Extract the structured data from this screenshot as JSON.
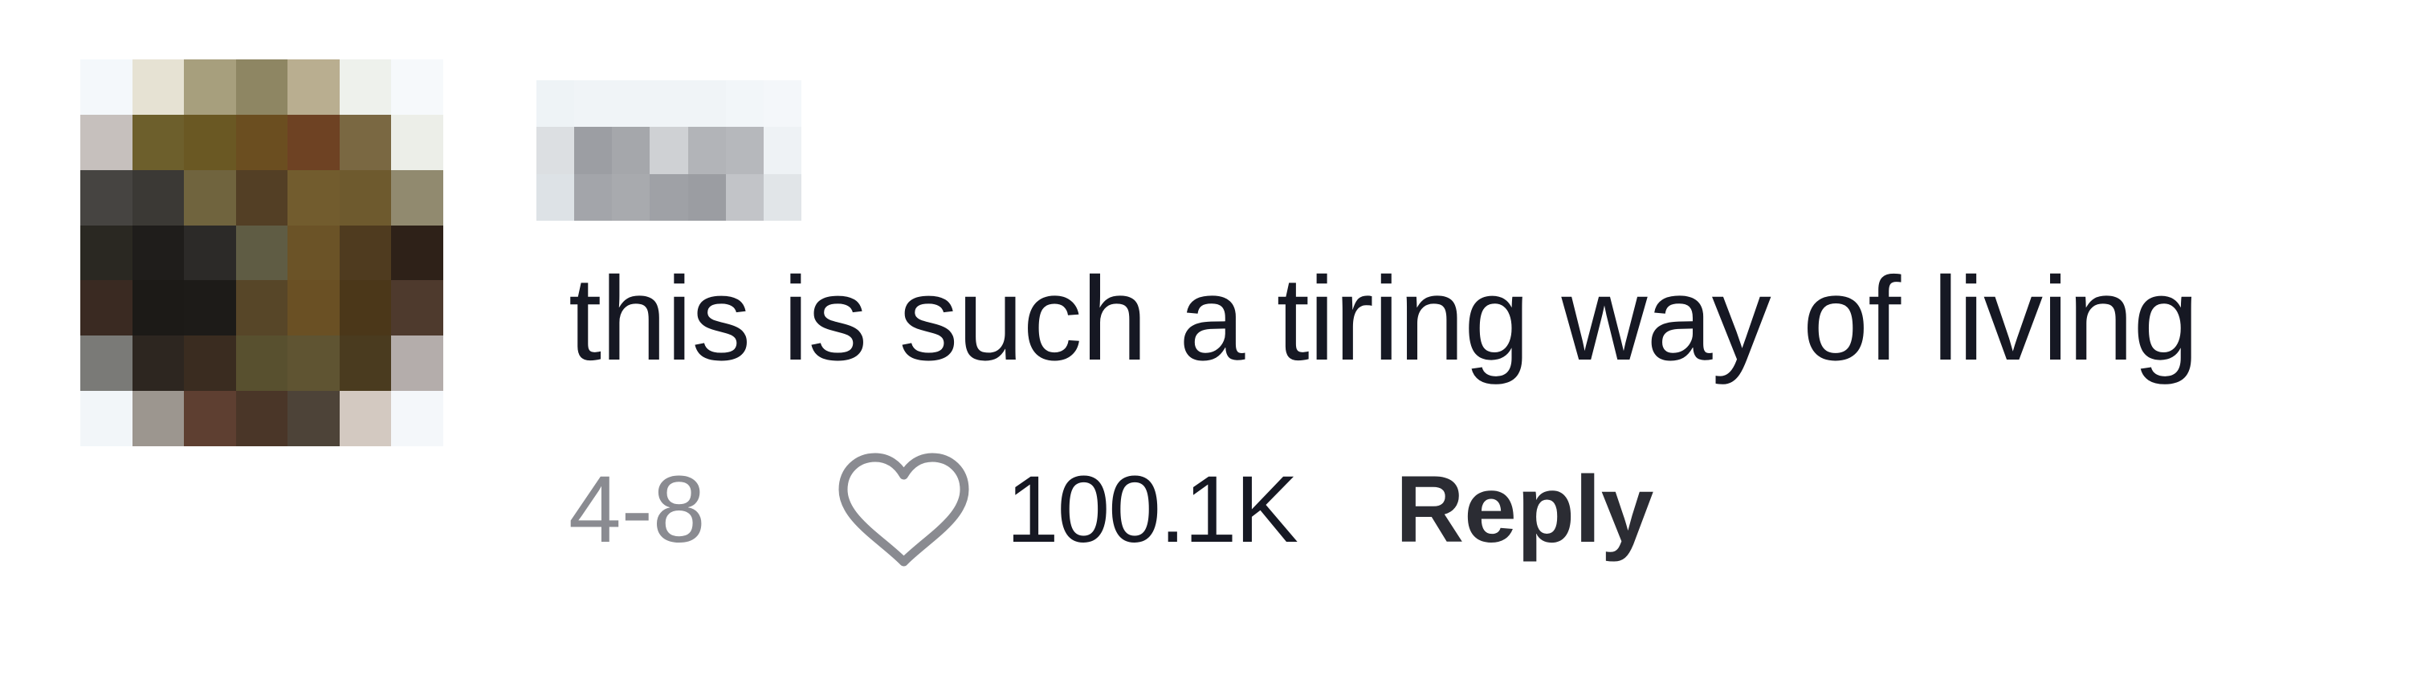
{
  "comment": {
    "text": "this is such a tiring way of living",
    "date": "4-8",
    "likes": "100.1K",
    "reply_label": "Reply",
    "liked": false
  },
  "icons": {
    "like": "heart-outline-icon"
  },
  "colors": {
    "text_primary": "#161823",
    "text_secondary": "#8a8b91",
    "heart_stroke": "#8a8b91",
    "background": "#ffffff"
  }
}
